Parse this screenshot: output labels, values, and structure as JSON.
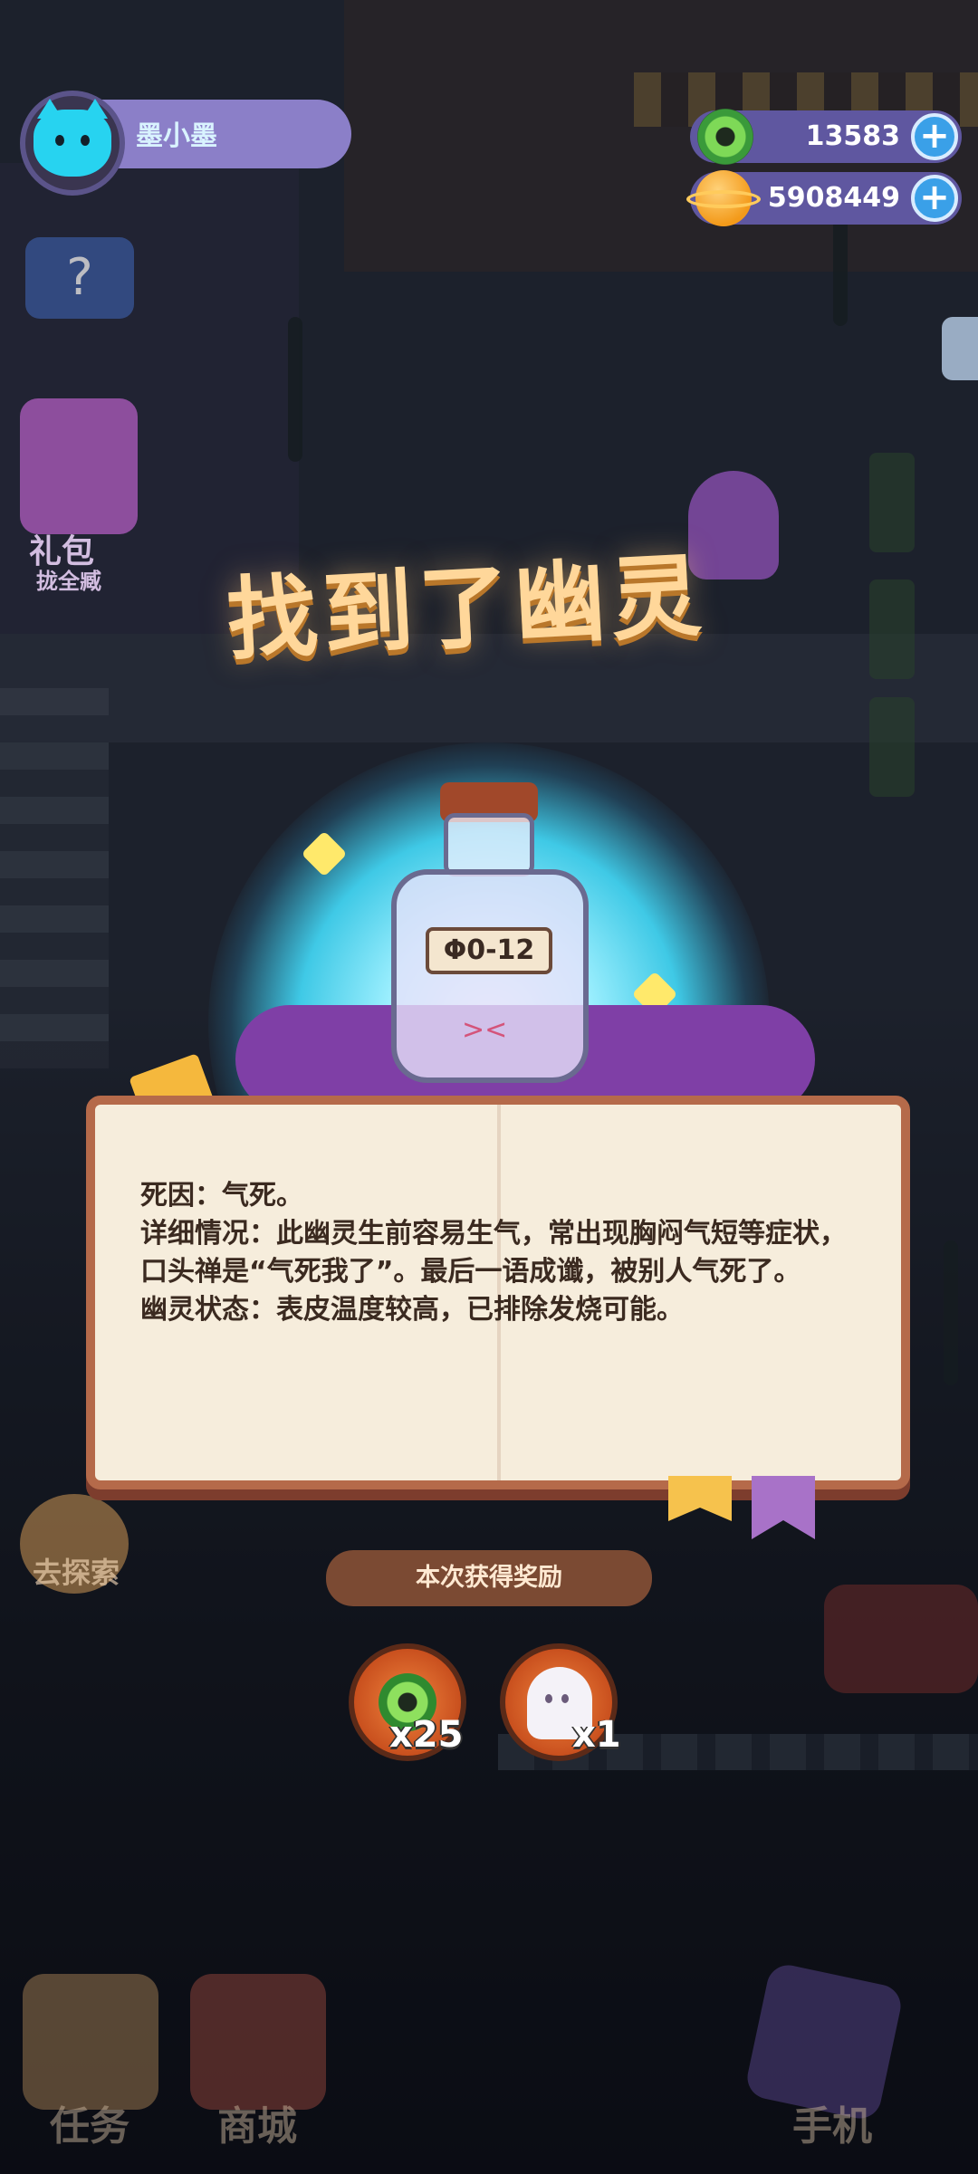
{
  "player": {
    "name": "墨小墨"
  },
  "currencies": {
    "donut": "13583",
    "planet": "5908449"
  },
  "side": {
    "gift_label": "礼包",
    "gift_sub": "拢全臧",
    "explore_label": "去探索",
    "question": "?"
  },
  "popup": {
    "title": "找到了幽灵",
    "bottle_label": "Φ0-12",
    "description": [
      "死因：气死。",
      "详细情况：此幽灵生前容易生气，常出现胸闷气短等症状，口头禅是“气死我了”。最后一语成谶，被别人气死了。",
      "幽灵状态：表皮温度较高，已排除发烧可能。"
    ],
    "reward_title": "本次获得奖励",
    "rewards": [
      {
        "icon": "donut-icon",
        "qty": "x25"
      },
      {
        "icon": "ghost-icon",
        "qty": "x1"
      }
    ]
  },
  "nav": {
    "task": "任务",
    "shop": "商城",
    "phone": "手机"
  }
}
